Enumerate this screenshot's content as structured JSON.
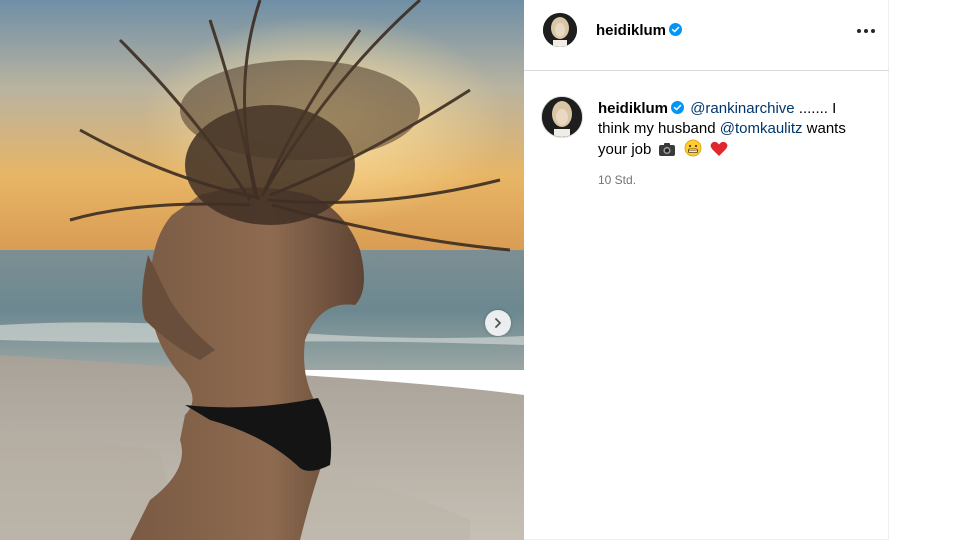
{
  "post": {
    "username": "heidiklum",
    "verified": true,
    "caption_prefix": " ",
    "mention1": "@rankinarchive",
    "caption_middle": " ....... I think my husband ",
    "mention2": "@tomkaulitz",
    "caption_suffix": " wants your job",
    "emojis": [
      "camera-emoji",
      "grimacing-face-emoji",
      "red-heart-emoji"
    ],
    "timestamp": "10 Std."
  },
  "icons": {
    "verified": "verified-badge-icon",
    "more": "more-options-icon",
    "next": "chevron-right-icon"
  },
  "colors": {
    "verified_blue": "#0095f6",
    "mention": "#00376b",
    "muted": "#737373"
  }
}
